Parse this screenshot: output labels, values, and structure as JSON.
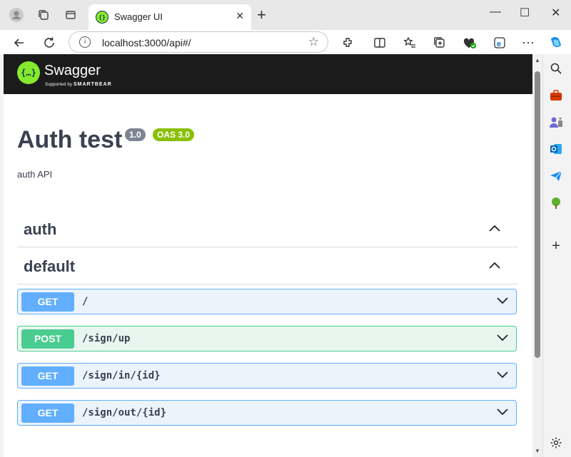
{
  "browser": {
    "tab_title": "Swagger UI",
    "tab_close": "✕",
    "new_tab": "+",
    "url": "localhost:3000/api#/",
    "url_info": "i",
    "more": "⋯",
    "window_controls": {
      "minimize": "—",
      "maximize": "☐",
      "close": "✕"
    }
  },
  "swagger": {
    "logo_mark": "{…}",
    "logo_text": "Swagger",
    "logo_sub_prefix": "Supported by",
    "logo_sub_brand": "SMARTBEAR"
  },
  "api": {
    "title": "Auth test",
    "version": "1.0",
    "oas": "OAS 3.0",
    "description": "auth API"
  },
  "tags": [
    {
      "name": "auth"
    },
    {
      "name": "default"
    }
  ],
  "operations": [
    {
      "method": "GET",
      "path": "/"
    },
    {
      "method": "POST",
      "path": "/sign/up"
    },
    {
      "method": "GET",
      "path": "/sign/in/{id}"
    },
    {
      "method": "GET",
      "path": "/sign/out/{id}"
    }
  ],
  "sidebar_add": "+",
  "colors": {
    "get": "#61affe",
    "post": "#49cc90",
    "swagger_green": "#85ea2d",
    "topbar": "#1b1b1b",
    "text": "#3b4151"
  }
}
